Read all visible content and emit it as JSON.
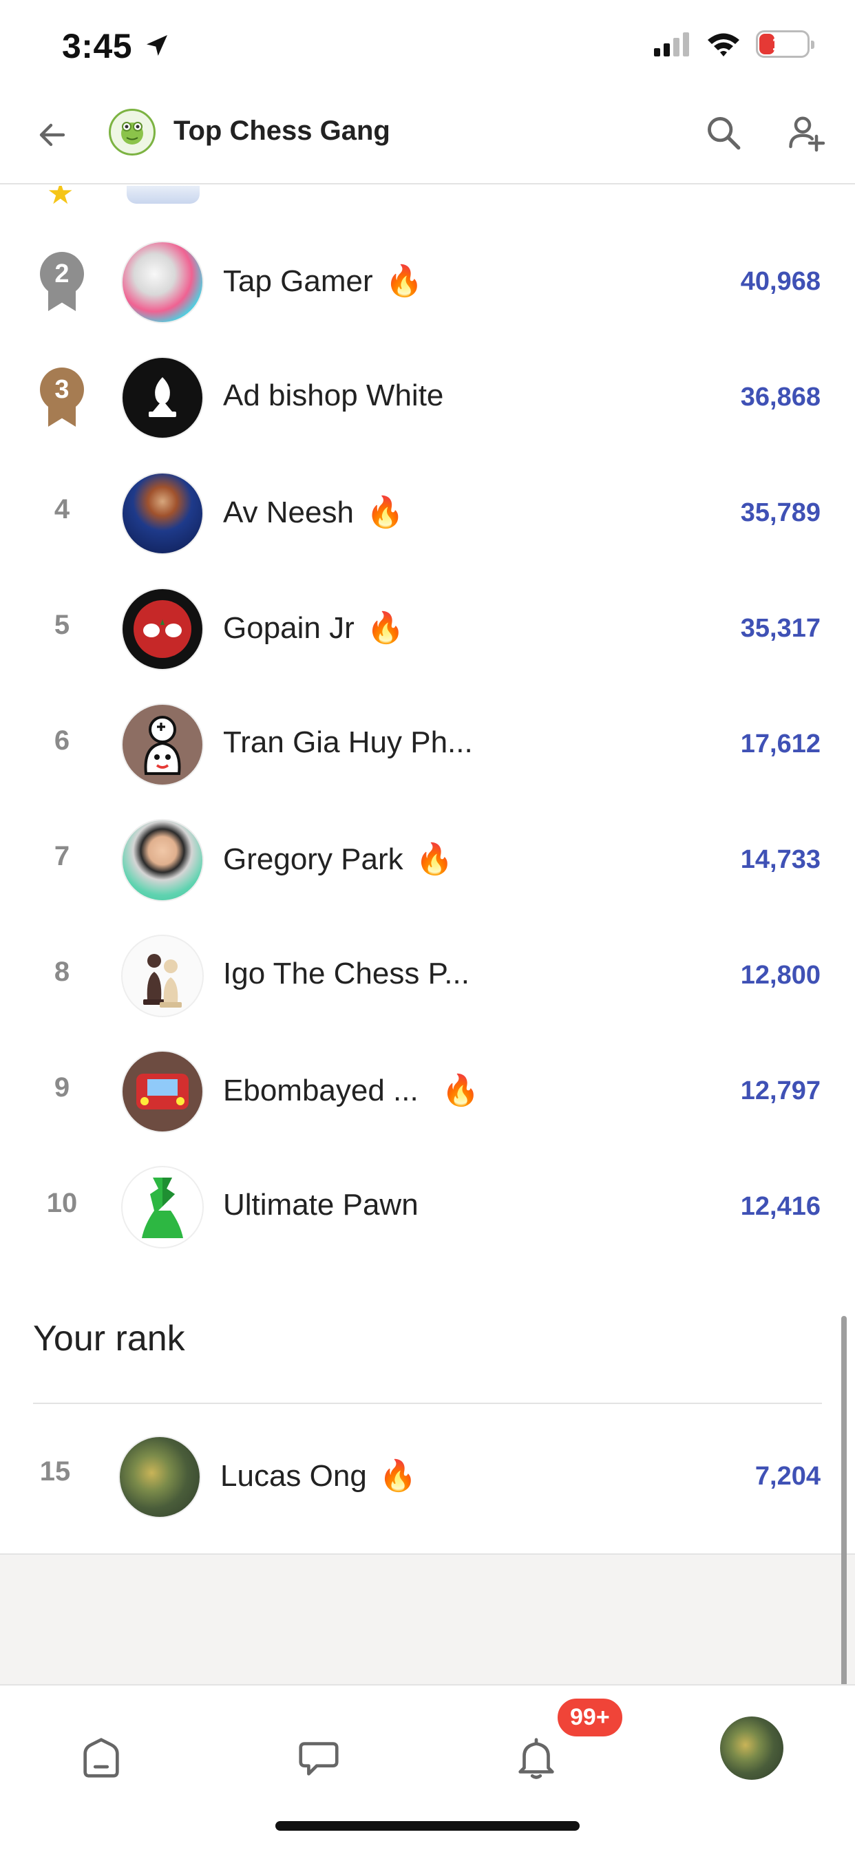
{
  "status": {
    "time": "3:45",
    "battery": "16"
  },
  "header": {
    "title": "Top Chess Gang"
  },
  "leaderboard": [
    {
      "rank": "2",
      "name": "Tap Gamer",
      "score": "40,968",
      "fire": true,
      "medal": "silver"
    },
    {
      "rank": "3",
      "name": "Ad bishop White",
      "score": "36,868",
      "fire": false,
      "medal": "bronze"
    },
    {
      "rank": "4",
      "name": "Av Neesh",
      "score": "35,789",
      "fire": true
    },
    {
      "rank": "5",
      "name": "Gopain Jr",
      "score": "35,317",
      "fire": true
    },
    {
      "rank": "6",
      "name": "Tran Gia Huy Ph...",
      "score": "17,612",
      "fire": false
    },
    {
      "rank": "7",
      "name": "Gregory Park",
      "score": "14,733",
      "fire": true
    },
    {
      "rank": "8",
      "name": "Igo The Chess P...",
      "score": "12,800",
      "fire": false
    },
    {
      "rank": "9",
      "name": "Ebombayed ...",
      "score": "12,797",
      "fire": true
    },
    {
      "rank": "10",
      "name": "Ultimate Pawn",
      "score": "12,416",
      "fire": false
    }
  ],
  "your_rank": {
    "title": "Your rank",
    "rank": "15",
    "name": "Lucas Ong",
    "score": "7,204",
    "fire": true
  },
  "notifications": {
    "badge": "99+"
  },
  "colors": {
    "score": "#3f51b5",
    "silver": "#8e8e8e",
    "bronze": "#a67c52",
    "badge": "#f04438"
  },
  "icons": [
    "back-arrow-icon",
    "search-icon",
    "add-user-icon",
    "home-icon",
    "chat-icon",
    "bell-icon",
    "fire-icon",
    "star-icon"
  ]
}
